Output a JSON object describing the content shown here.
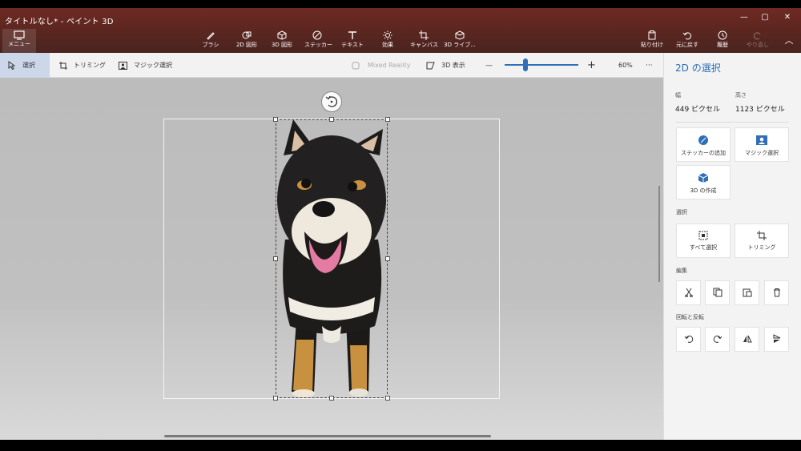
{
  "window": {
    "title": "タイトルなし* - ペイント 3D",
    "minimize": "—",
    "maximize": "▢",
    "close": "✕"
  },
  "menu": {
    "label": "メニュー"
  },
  "tools": [
    {
      "label": "ブラシ",
      "icon": "brush-icon"
    },
    {
      "label": "2D 図形",
      "icon": "2d-shapes-icon"
    },
    {
      "label": "3D 図形",
      "icon": "3d-shapes-icon"
    },
    {
      "label": "ステッカー",
      "icon": "sticker-icon"
    },
    {
      "label": "テキスト",
      "icon": "text-icon"
    },
    {
      "label": "効果",
      "icon": "effects-icon"
    },
    {
      "label": "キャンバス",
      "icon": "canvas-icon"
    },
    {
      "label": "3D ライブ...",
      "icon": "3d-library-icon"
    }
  ],
  "right_tools": {
    "paste": "貼り付け",
    "undo": "元に戻す",
    "history": "履歴",
    "redo": "やり直し"
  },
  "subbar": {
    "select": "選択",
    "crop": "トリミング",
    "magic_select": "マジック選択",
    "mixed_reality": "Mixed Reality",
    "view3d": "3D 表示",
    "zoom_minus": "—",
    "zoom_plus": "+",
    "zoom_value": "60%",
    "zoom_fraction": 0.28,
    "more": "···"
  },
  "panel": {
    "title": "2D の選択",
    "width_label": "幅",
    "width_value": "449 ピクセル",
    "height_label": "高さ",
    "height_value": "1123 ピクセル",
    "add_sticker": "ステッカーの追加",
    "magic_select": "マジック選択",
    "make_3d": "3D の作成",
    "section_select": "選択",
    "select_all": "すべて選択",
    "crop": "トリミング",
    "section_edit": "編集",
    "section_rotate": "回転と反転"
  },
  "colors": {
    "accent": "#2f6fb7",
    "titlebar": "#5a2620",
    "panel_title": "#2a6db5"
  }
}
